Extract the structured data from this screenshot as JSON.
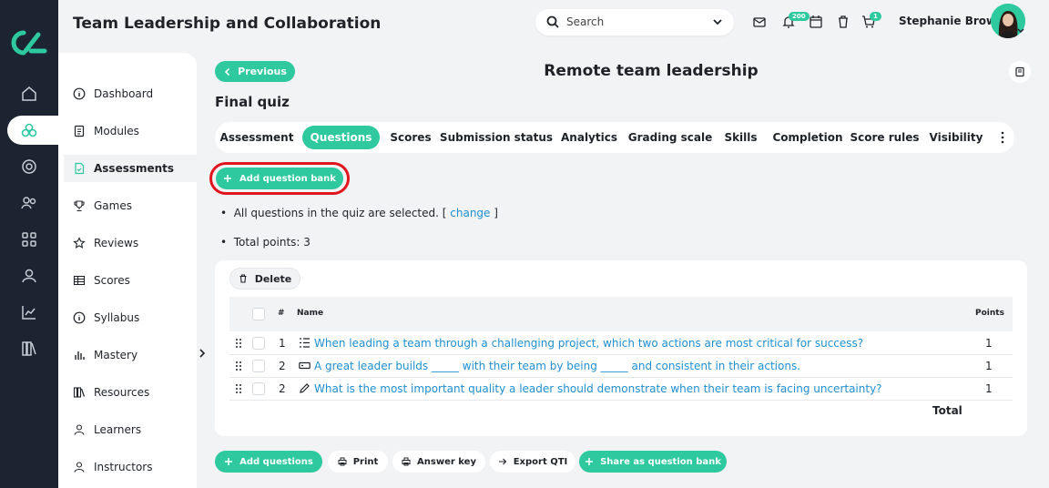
{
  "app": {
    "title": "Team Leadership and Collaboration"
  },
  "header": {
    "search_placeholder": "Search",
    "notifications_count": "200",
    "cart_count": "1",
    "user_name": "Stephanie Brown"
  },
  "sidebar": {
    "items": [
      {
        "label": "Dashboard",
        "icon": "info-icon"
      },
      {
        "label": "Modules",
        "icon": "document-icon"
      },
      {
        "label": "Assessments",
        "icon": "assessment-icon"
      },
      {
        "label": "Games",
        "icon": "trophy-icon"
      },
      {
        "label": "Reviews",
        "icon": "star-icon"
      },
      {
        "label": "Scores",
        "icon": "table-icon"
      },
      {
        "label": "Syllabus",
        "icon": "info-icon"
      },
      {
        "label": "Mastery",
        "icon": "bar-chart-icon"
      },
      {
        "label": "Resources",
        "icon": "library-icon"
      },
      {
        "label": "Learners",
        "icon": "user-icon"
      },
      {
        "label": "Instructors",
        "icon": "user-icon"
      }
    ],
    "active": "Assessments"
  },
  "page": {
    "previous_label": "Previous",
    "title": "Remote team leadership",
    "quiz_title": "Final quiz"
  },
  "tabs": [
    "Assessment",
    "Questions",
    "Scores",
    "Submission status",
    "Analytics",
    "Grading scale",
    "Skills",
    "Completion",
    "Score rules",
    "Visibility"
  ],
  "active_tab": "Questions",
  "actions": {
    "add_question_bank": "Add question bank",
    "delete": "Delete",
    "add_questions": "Add questions",
    "print": "Print",
    "answer_key": "Answer key",
    "export_qti": "Export QTI",
    "share_as_bank": "Share as question bank"
  },
  "info": {
    "selected_text": "All questions in the quiz are selected. [",
    "change_link": "change",
    "selected_close": "]",
    "total_points": "Total points: 3"
  },
  "table": {
    "headers": {
      "num": "#",
      "name": "Name",
      "points": "Points"
    },
    "rows": [
      {
        "num": "1",
        "type": "list-icon",
        "name": "When leading a team through a challenging project, which two actions are most critical for success?",
        "points": "1"
      },
      {
        "num": "2",
        "type": "blank-icon",
        "name": "A great leader builds _____ with their team by being _____ and consistent in their actions.",
        "points": "1"
      },
      {
        "num": "2",
        "type": "pencil-icon",
        "name": "What is the most important quality a leader should demonstrate when their team is facing uncertainty?",
        "points": "1"
      }
    ],
    "total_label": "Total"
  },
  "colors": {
    "accent": "#2ec99f",
    "rail": "#1c2331",
    "link": "#1f8fd1",
    "highlight": "#e0161e"
  }
}
